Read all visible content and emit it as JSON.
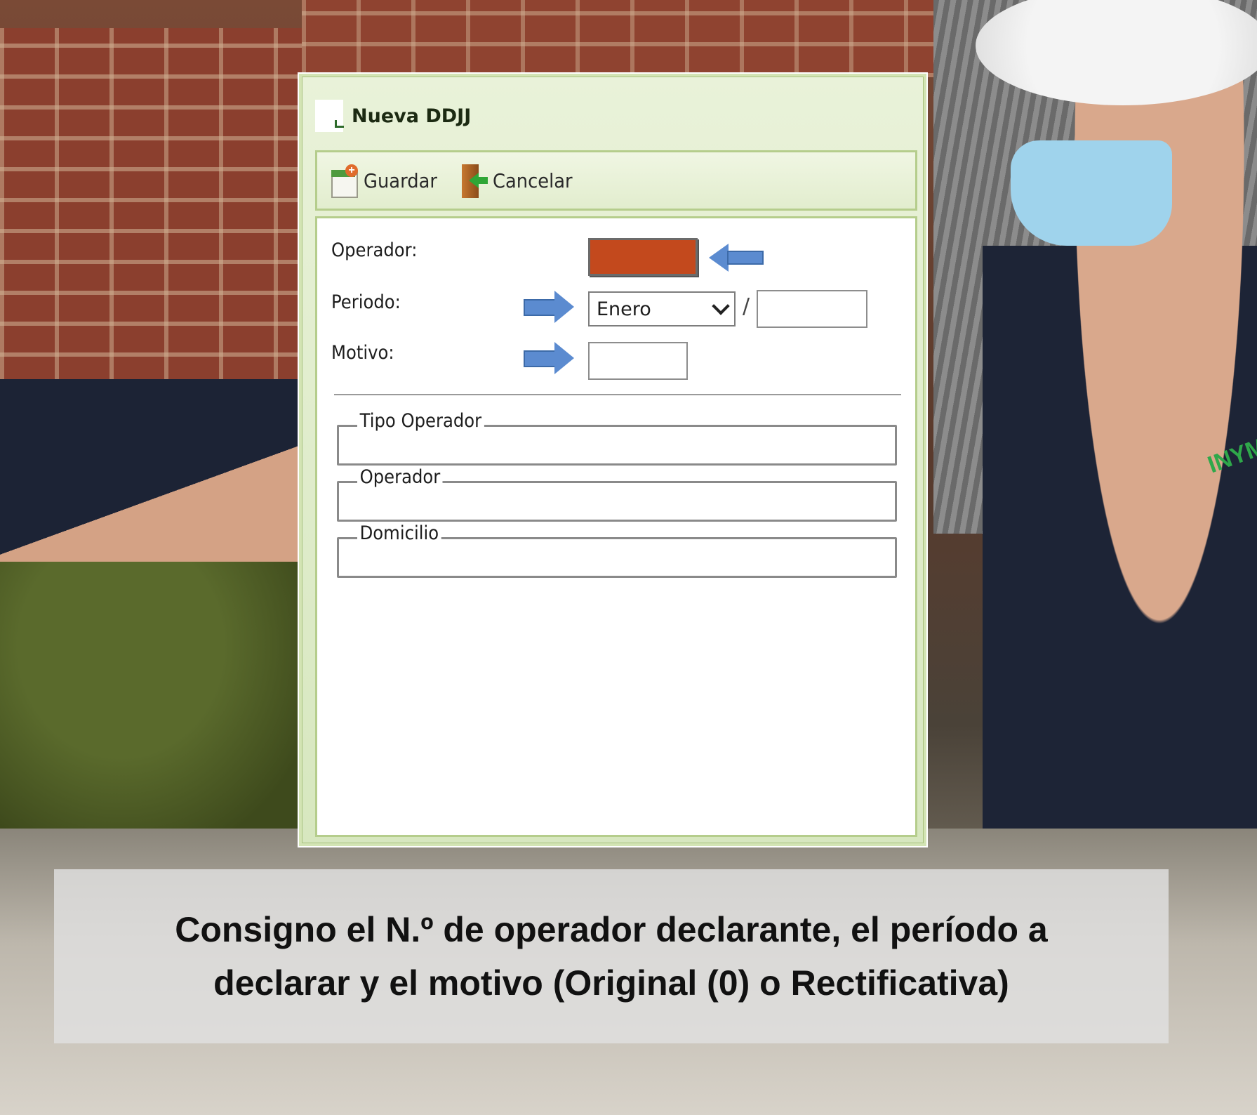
{
  "window": {
    "title": "Nueva DDJJ"
  },
  "toolbar": {
    "save_label": "Guardar",
    "cancel_label": "Cancelar"
  },
  "form": {
    "operador_label": "Operador:",
    "periodo_label": "Periodo:",
    "periodo_month": "Enero",
    "periodo_separator": "/",
    "periodo_year": "",
    "motivo_label": "Motivo:",
    "motivo_value": "",
    "operador_value": ""
  },
  "groups": [
    {
      "legend": "Tipo Operador"
    },
    {
      "legend": "Operador"
    },
    {
      "legend": "Domicilio"
    }
  ],
  "caption": {
    "line1": "Consigno el N.º de operador declarante, el período a",
    "line2": "declarar y el motivo (Original (0) o Rectificativa)"
  },
  "background": {
    "logo_text": "INYM"
  },
  "colors": {
    "highlight": "#c3491d",
    "arrow": "#5b8bd0",
    "dialog_green": "#d3e4b4"
  }
}
